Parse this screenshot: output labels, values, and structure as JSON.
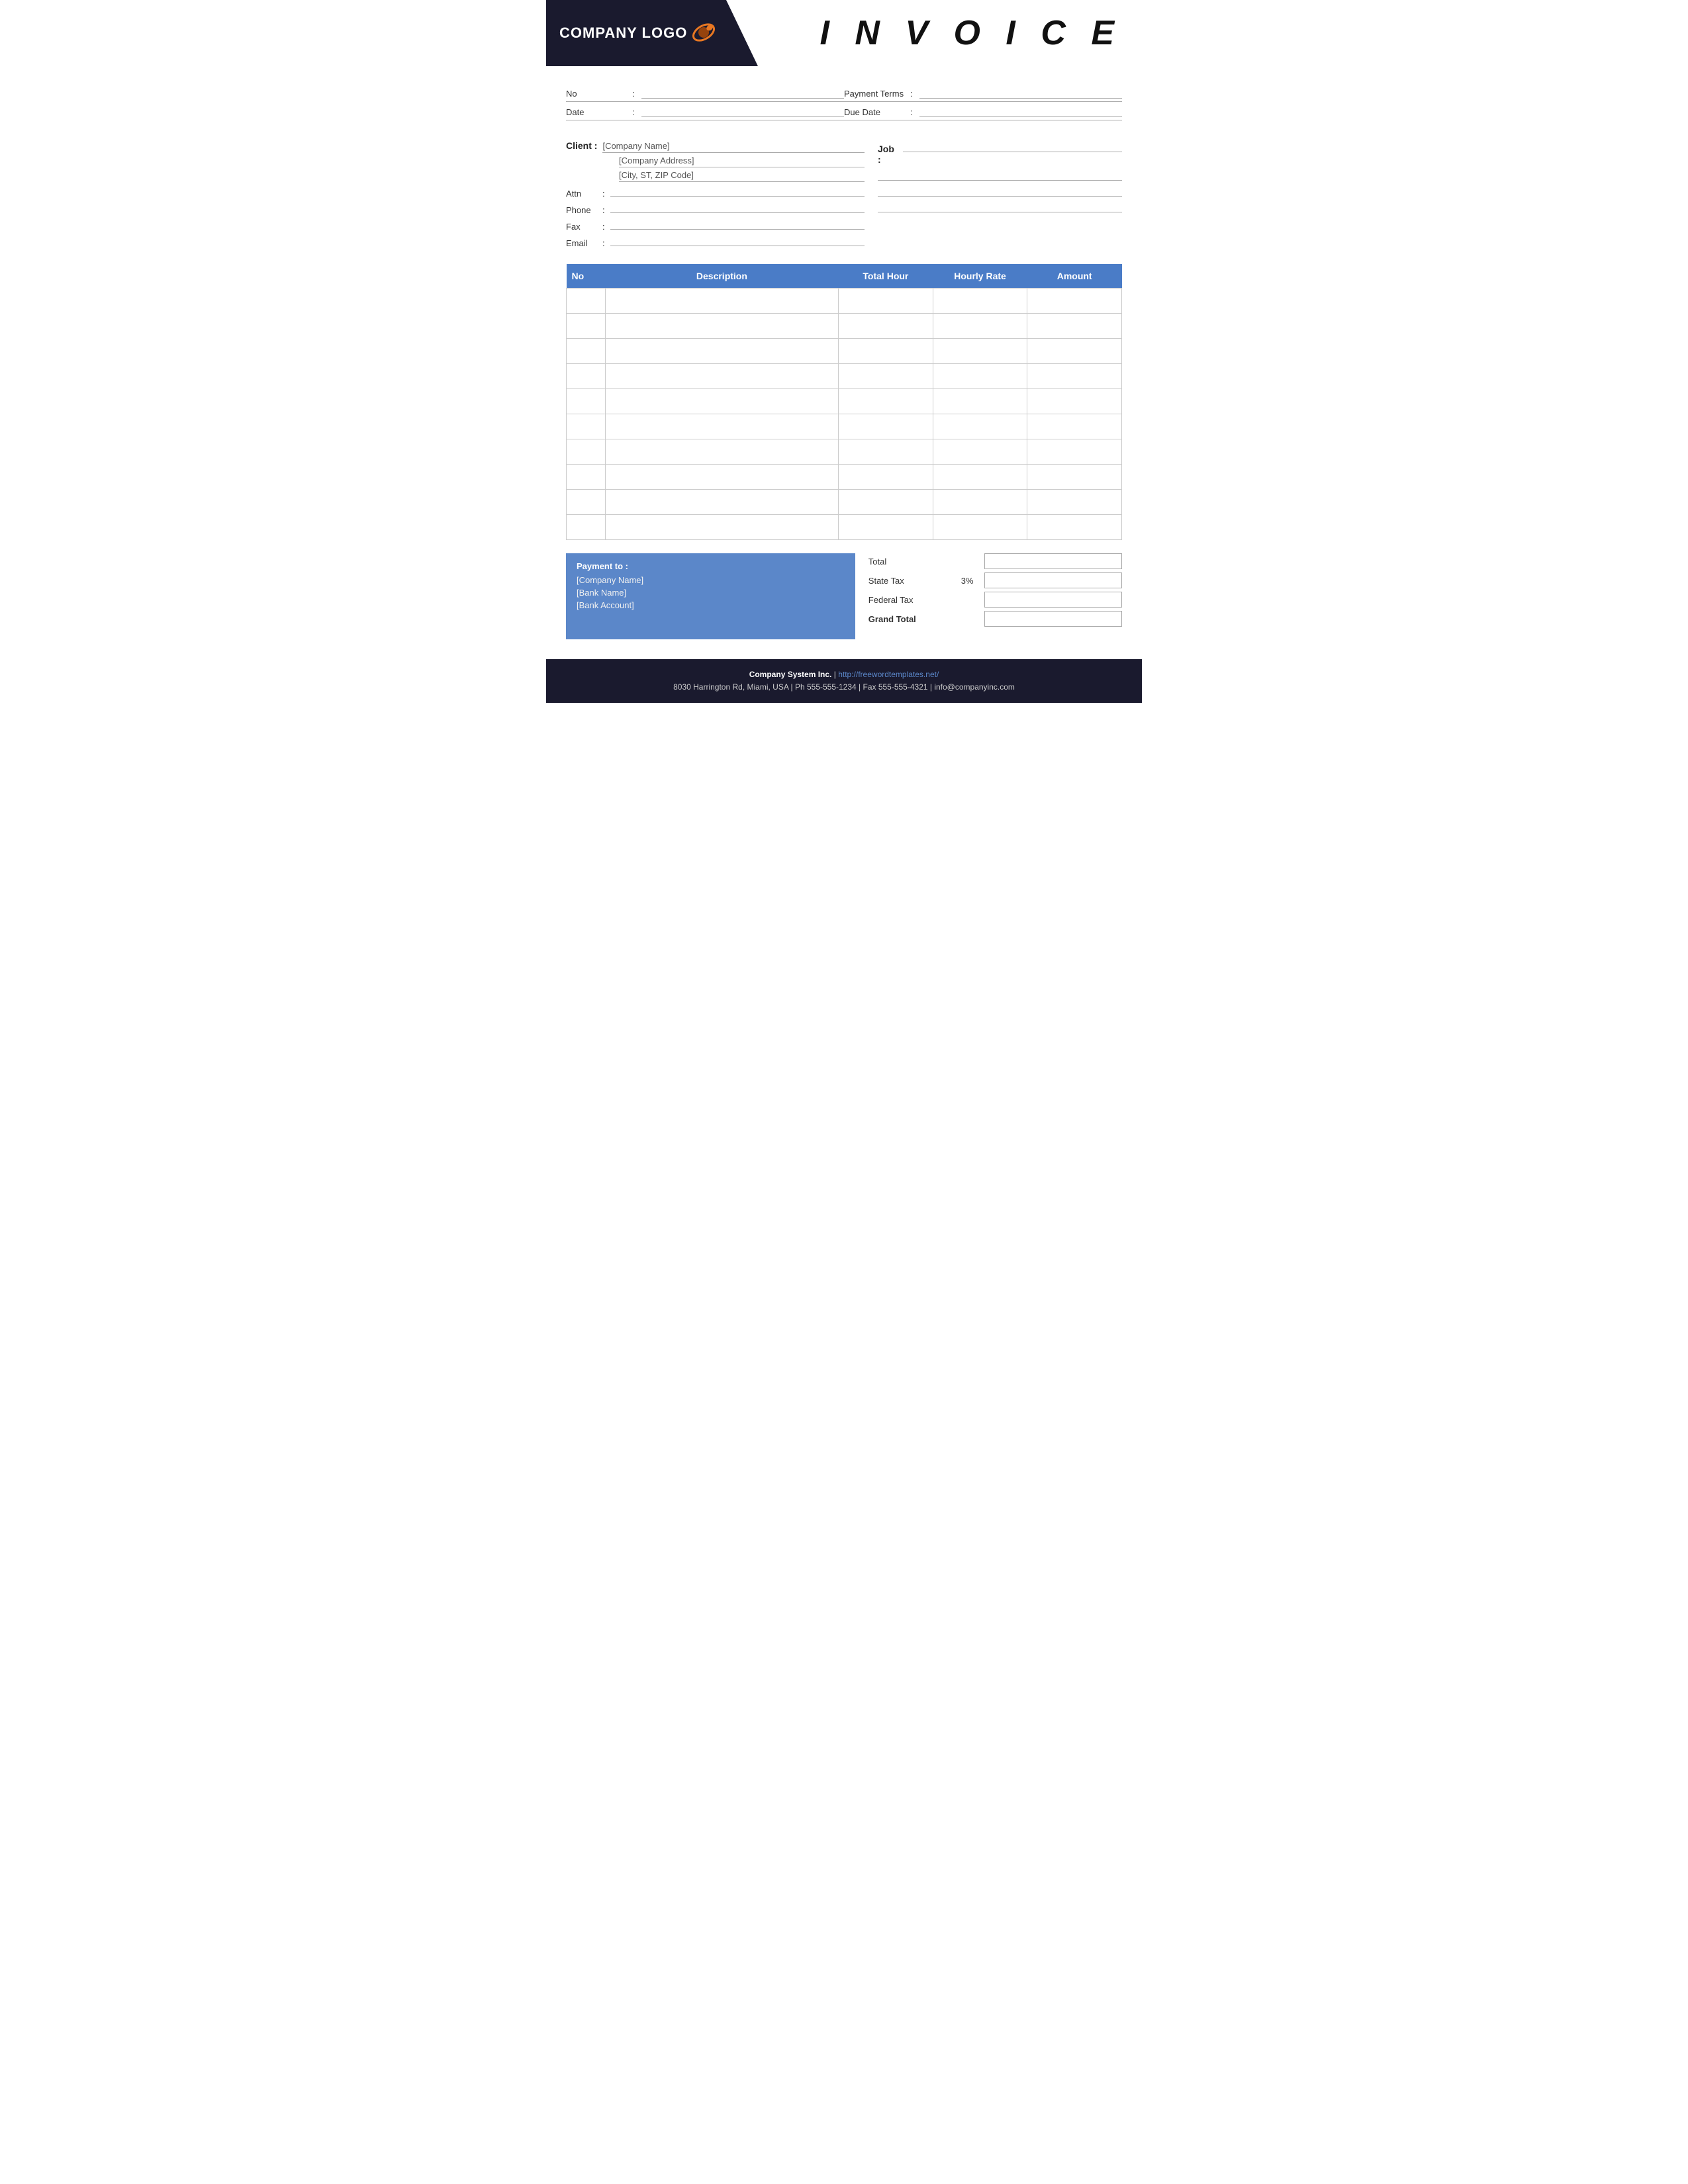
{
  "header": {
    "logo_text": "COMPANY LOGO",
    "invoice_title": "I N V O I C E"
  },
  "meta": {
    "no_label": "No",
    "no_colon": ":",
    "payment_terms_label": "Payment  Terms",
    "payment_terms_colon": ":",
    "date_label": "Date",
    "date_colon": ":",
    "due_date_label": "Due Date",
    "due_date_colon": ":"
  },
  "client": {
    "label": "Client  :",
    "company_name": "[Company Name]",
    "company_address": "[Company Address]",
    "city_state_zip": "[City, ST, ZIP Code]",
    "attn_label": "Attn",
    "attn_colon": ":",
    "phone_label": "Phone",
    "phone_colon": ":",
    "fax_label": "Fax",
    "fax_colon": ":",
    "email_label": "Email",
    "email_colon": ":"
  },
  "job": {
    "label": "Job  :"
  },
  "table": {
    "headers": [
      "No",
      "Description",
      "Total Hour",
      "Hourly Rate",
      "Amount"
    ],
    "empty_rows": 10
  },
  "payment": {
    "label": "Payment to :",
    "company_name": "[Company Name]",
    "bank_name": "[Bank Name]",
    "bank_account": "[Bank Account]"
  },
  "totals": {
    "total_label": "Total",
    "state_tax_label": "State Tax",
    "state_tax_percent": "3%",
    "federal_tax_label": "Federal Tax",
    "grand_total_label": "Grand Total"
  },
  "footer": {
    "company": "Company System Inc.",
    "separator": " | ",
    "website": "http://freewordtemplates.net/",
    "address": "8030 Harrington Rd, Miami, USA | Ph 555-555-1234 | Fax 555-555-4321 | info@companyinc.com"
  }
}
